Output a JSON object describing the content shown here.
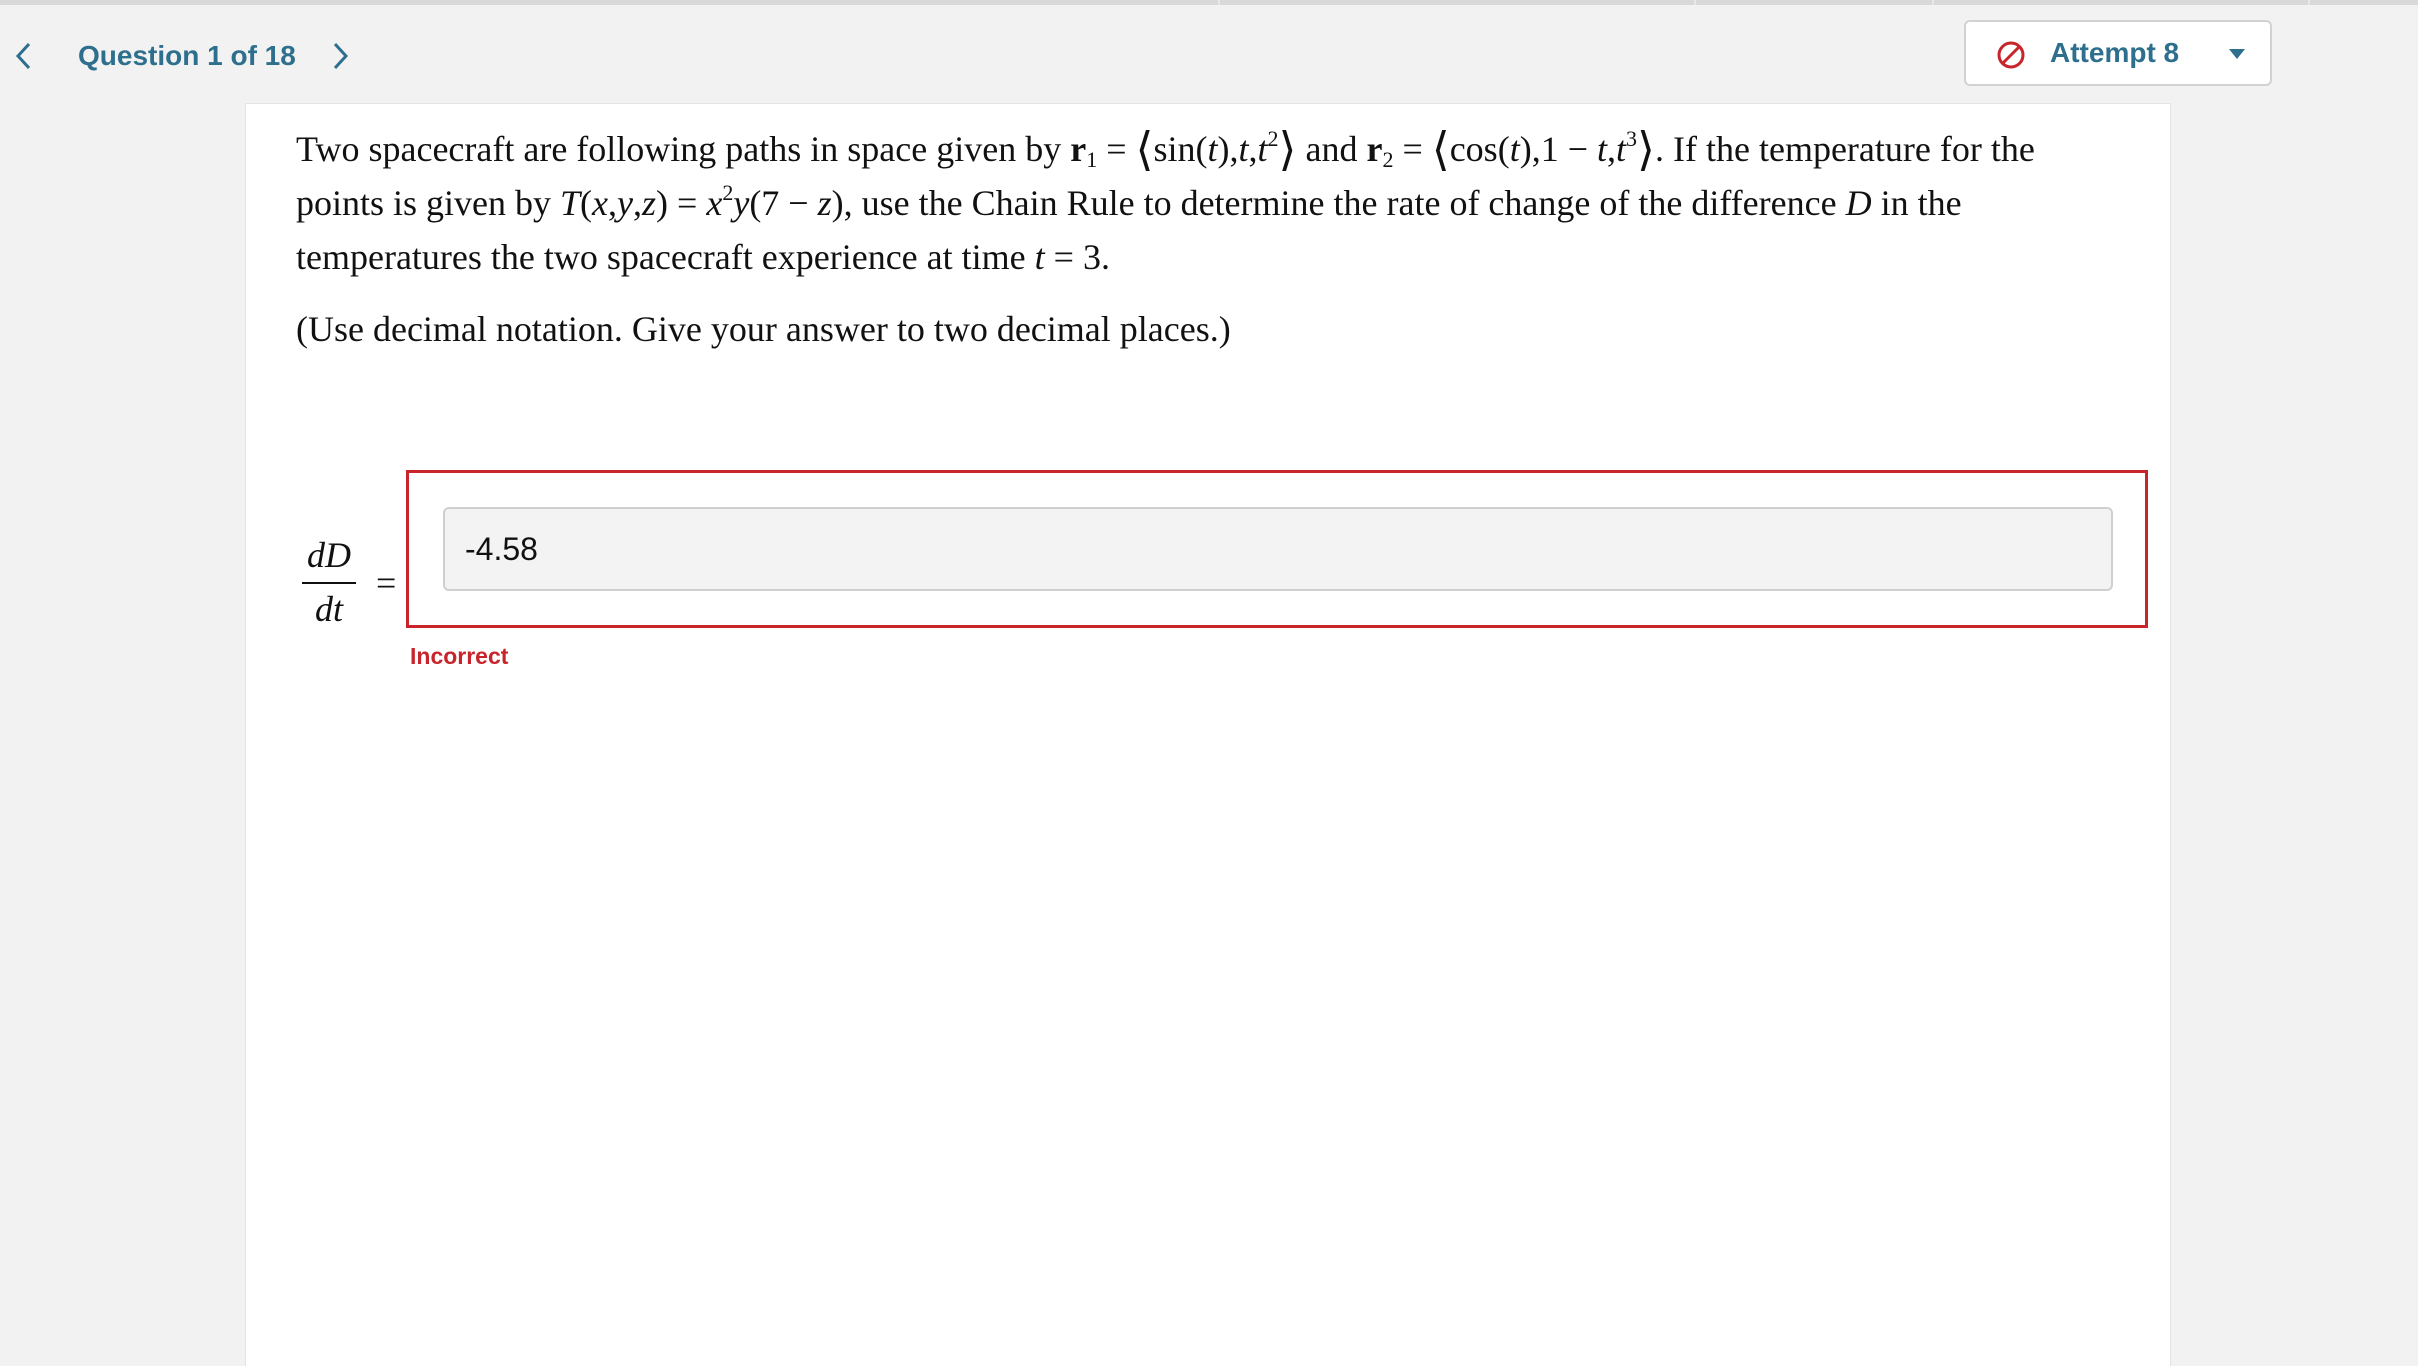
{
  "header": {
    "question_counter": "Question 1 of 18",
    "prev_icon": "chevron-left-icon",
    "next_icon": "chevron-right-icon",
    "attempt": {
      "label": "Attempt 8",
      "status_icon": "ban-icon",
      "status_color": "#c8242b",
      "dropdown_icon": "caret-down-icon"
    },
    "accent_color": "#2d6f8c"
  },
  "question": {
    "text_1": "Two spacecraft are following paths in space given by",
    "r1_symbol": "r",
    "r1_subscript": "1",
    "eq_1": "=",
    "r1_open": "⟨",
    "r1_x": "sin(",
    "r1_x_t": "t",
    "r1_x_close": "),",
    "r1_y": "t",
    "r1_y_sep": ",",
    "r1_z": "t",
    "r1_z_exp": "2",
    "r1_close": "⟩",
    "text_and": "and",
    "r2_symbol": "r",
    "r2_subscript": "2",
    "eq_2": "=",
    "r2_open": "⟨",
    "r2_x": "cos(",
    "r2_x_t": "t",
    "r2_x_close": "),",
    "r2_y_pre": "1 −",
    "r2_y_t": "t",
    "r2_y_sep": ",",
    "r2_z": "t",
    "r2_z_exp": "3",
    "r2_close": "⟩",
    "text_2": ". If the temperature for the points is given by",
    "T_func": "T",
    "T_args_open": "(",
    "T_x": "x",
    "T_c1": ",",
    "T_y": "y",
    "T_c2": ",",
    "T_z": "z",
    "T_args_close": ")",
    "eq_3": "=",
    "T_rhs_x": "x",
    "T_rhs_x_exp": "2",
    "T_rhs_y": "y",
    "T_rhs_paren_open": "(7 −",
    "T_rhs_z": "z",
    "T_rhs_paren_close": "),",
    "text_3": "use the Chain Rule to determine the rate of change of the difference",
    "D_symbol": "D",
    "text_4": "in the temperatures the two spacecraft experience at time",
    "t_symbol": "t",
    "t_eq": "= 3.",
    "instruction": "(Use decimal notation. Give your answer to two decimal places.)"
  },
  "answer": {
    "fraction_numerator": "dD",
    "fraction_denominator": "dt",
    "equals": "=",
    "value": "-4.58",
    "feedback": "Incorrect",
    "feedback_color": "#c8242b"
  }
}
